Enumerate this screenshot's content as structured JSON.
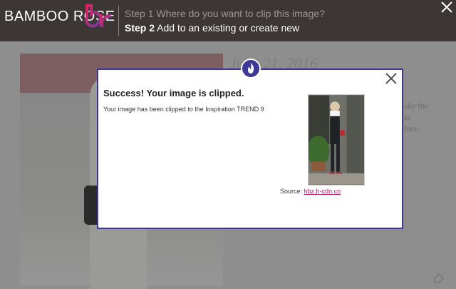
{
  "header": {
    "brand": "BAMBOO ROSE",
    "step1_num": "Step 1",
    "step1_text": "Where do you want to clip this image?",
    "step2_num": "Step 2",
    "step2_text": "Add to an existing or create new"
  },
  "background": {
    "date": "June 21, 2016",
    "text_lines": [
      "ake the",
      "ss",
      "ham."
    ]
  },
  "modal": {
    "title": "Success! Your image is clipped.",
    "message": "Your image has been clipped to the Inspiration TREND 9",
    "source_label": "Source:",
    "source_link": "hbz.h-cdn.co"
  },
  "colors": {
    "topbar": "#3c3734",
    "modal_border": "#3d3796",
    "link": "#b0216a",
    "logo_gradient": [
      "#e0245e",
      "#7b3fa0"
    ]
  }
}
